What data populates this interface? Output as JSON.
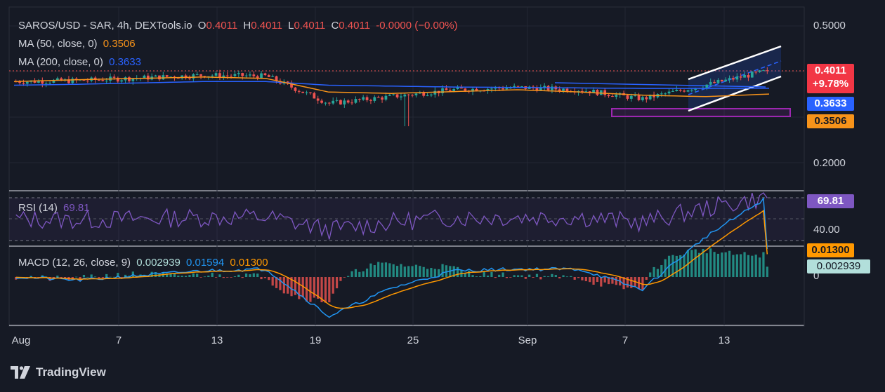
{
  "header": {
    "symbol": "SAROS/USD - SAR, 4h, DEXTools.io",
    "o_label": "O",
    "o_val": "0.4011",
    "h_label": "H",
    "h_val": "0.4011",
    "l_label": "L",
    "l_val": "0.4011",
    "c_label": "C",
    "c_val": "0.4011",
    "change": "-0.0000 (−0.00%)",
    "ma50_label": "MA (50, close, 0)",
    "ma50_val": "0.3506",
    "ma200_label": "MA (200, close, 0)",
    "ma200_val": "0.3633"
  },
  "rsi": {
    "label": "RSI (14)",
    "value": "69.81",
    "axis_tick": "40.00",
    "tag": "69.81"
  },
  "macd": {
    "label": "MACD (12, 26, close, 9)",
    "hist": "0.002939",
    "macd_line": "0.01594",
    "signal": "0.01300",
    "tag_signal": "0.01300",
    "tag_hist": "0.002939",
    "axis_zero": "0"
  },
  "price_tags": {
    "price": "0.4011",
    "pct": "+9.78%",
    "ma200": "0.3633",
    "ma50": "0.3506"
  },
  "y_axis_labels": [
    "0.5000",
    "0.2000"
  ],
  "x_axis_labels": [
    "Aug",
    "7",
    "13",
    "19",
    "25",
    "Sep",
    "7",
    "13"
  ],
  "brand": "TradingView",
  "colors": {
    "background": "#161a25",
    "up": "#26a69a",
    "down": "#ef5350",
    "ma50": "#f7931a",
    "ma200": "#2962ff",
    "rsi": "#7e57c2",
    "macd": "#2196f3",
    "signal": "#ff9800"
  },
  "chart_data": {
    "type": "candlestick",
    "title": "SAROS/USD - SAR, 4h, DEXTools.io",
    "x": [
      "Aug",
      "7",
      "13",
      "19",
      "25",
      "Sep",
      "7",
      "13"
    ],
    "close": [
      0.378,
      0.38,
      0.386,
      0.392,
      0.39,
      0.33,
      0.345,
      0.36,
      0.365,
      0.36,
      0.34,
      0.37,
      0.4011
    ],
    "ma50": [
      0.378,
      0.382,
      0.385,
      0.388,
      0.385,
      0.355,
      0.352,
      0.356,
      0.36,
      0.355,
      0.348,
      0.345,
      0.3506
    ],
    "ma200": [
      0.37,
      0.372,
      0.375,
      0.378,
      0.378,
      0.37,
      0.368,
      0.366,
      0.365,
      0.364,
      0.363,
      0.363,
      0.3633
    ],
    "last_price": 0.4011,
    "change_pct": 9.78,
    "ylim_visible_ticks": [
      0.5,
      0.2
    ],
    "rsi_last": 69.81,
    "macd_hist_last": 0.002939,
    "macd_line_last": 0.01594,
    "macd_signal_last": 0.013,
    "annotations": [
      "ascending channel",
      "support zone box"
    ]
  }
}
